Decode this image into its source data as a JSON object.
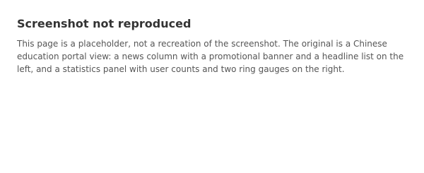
{
  "notice": {
    "title": "Screenshot not reproduced",
    "body": "This page is a placeholder, not a recreation of the screenshot. The original is a Chinese education portal view: a news column with a promotional banner and a headline list on the left, and a statistics panel with user counts and two ring gauges on the right."
  }
}
